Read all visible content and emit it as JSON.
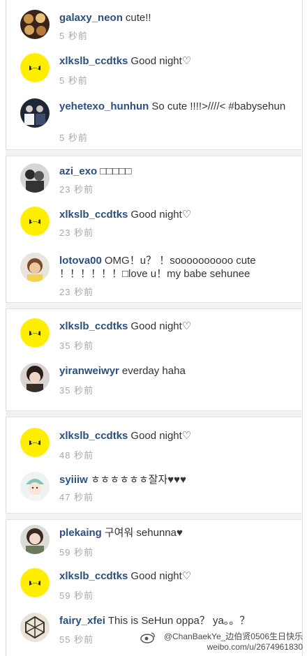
{
  "comments": [
    {
      "username": "galaxy_neon",
      "text": "cute!!",
      "time": "5 秒前",
      "avatar": "food-photo-avatar"
    },
    {
      "username": "xlkslb_ccdtks",
      "text": "Good night♡",
      "time": "5 秒前",
      "avatar": "yellow-logo-avatar"
    },
    {
      "username": "yehetexo_hunhun",
      "text": "So cute !!!!>////< #babysehun",
      "time": "5 秒前",
      "avatar": "group-photo-avatar"
    },
    {
      "username": "azi_exo",
      "text": "□□□□□",
      "time": "23 秒前",
      "avatar": "bw-photo-avatar"
    },
    {
      "username": "xlkslb_ccdtks",
      "text": "Good night♡",
      "time": "23 秒前",
      "avatar": "yellow-logo-avatar"
    },
    {
      "username": "lotova00",
      "text": "OMG！u？ ！soooooooooo cute ！！！！！！□love u！my babe sehunee",
      "time": "23 秒前",
      "avatar": "child-photo-avatar"
    },
    {
      "username": "xlkslb_ccdtks",
      "text": "Good night♡",
      "time": "35 秒前",
      "avatar": "yellow-logo-avatar"
    },
    {
      "username": "yiranweiwyr",
      "text": "everday haha",
      "time": "35 秒前",
      "avatar": "girl-photo-avatar"
    },
    {
      "username": "xlkslb_ccdtks",
      "text": "Good night♡",
      "time": "48 秒前",
      "avatar": "yellow-logo-avatar"
    },
    {
      "username": "syiiiw",
      "text": "ㅎㅎㅎㅎㅎㅎ잘자♥♥♥",
      "time": "47 秒前",
      "avatar": "cartoon-avatar"
    },
    {
      "username": "plekaing",
      "text": "구여워 sehunna♥",
      "time": "59 秒前",
      "avatar": "woman-photo-avatar"
    },
    {
      "username": "xlkslb_ccdtks",
      "text": "Good night♡",
      "time": "59 秒前",
      "avatar": "yellow-logo-avatar"
    },
    {
      "username": "fairy_xfei",
      "text": "This is SeHun oppa？ ya。。？",
      "time": "55 秒前",
      "avatar": "exo-logo-avatar"
    }
  ],
  "watermark": {
    "line1": "@ChanBaekYe_边伯贤0506生日快乐",
    "line2": "weibo.com/u/2674961830"
  },
  "colors": {
    "username": "#2b4f7e",
    "time": "#a8a8a8",
    "logo_yellow": "#ffee00"
  }
}
